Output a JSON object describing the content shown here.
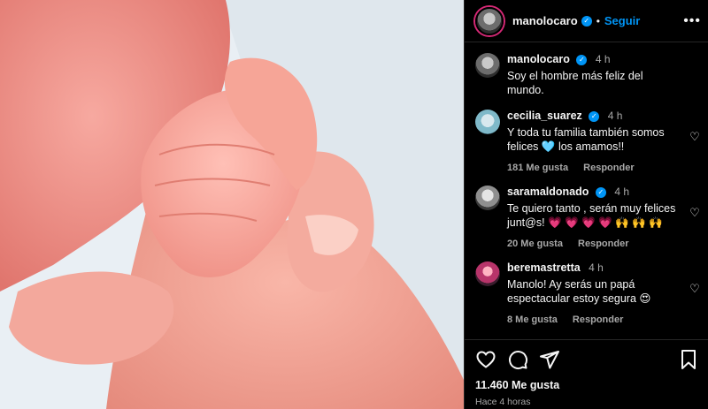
{
  "post": {
    "author": "manolocaro",
    "follow_label": "Seguir",
    "caption_time": "4 h",
    "caption": "Soy el hombre más feliz del mundo.",
    "likes": "11.460 Me gusta",
    "posted": "Hace 4 horas"
  },
  "comments": [
    {
      "user": "cecilia_suarez",
      "time": "4 h",
      "text": "Y toda tu familia también somos felices 🩵 los amamos!!",
      "likes": "181 Me gusta",
      "reply": "Responder"
    },
    {
      "user": "saramaldonado",
      "time": "4 h",
      "text": "Te quiero tanto , serán muy felices junt@s! 💗 💗 💗 💗 🙌 🙌 🙌",
      "likes": "20 Me gusta",
      "reply": "Responder"
    },
    {
      "user": "beremastretta",
      "time": "4 h",
      "text": "Manolo! Ay serás un papá espectacular estoy segura 😍",
      "likes": "8 Me gusta",
      "reply": "Responder"
    }
  ],
  "icons": {
    "more": "more-options-icon",
    "verified": "verified-badge-icon",
    "like": "heart-icon",
    "comment": "comment-icon",
    "share": "share-icon",
    "save": "bookmark-icon"
  },
  "colors": {
    "background": "#000000",
    "accent": "#0095f6",
    "muted": "#a8a8a8"
  }
}
